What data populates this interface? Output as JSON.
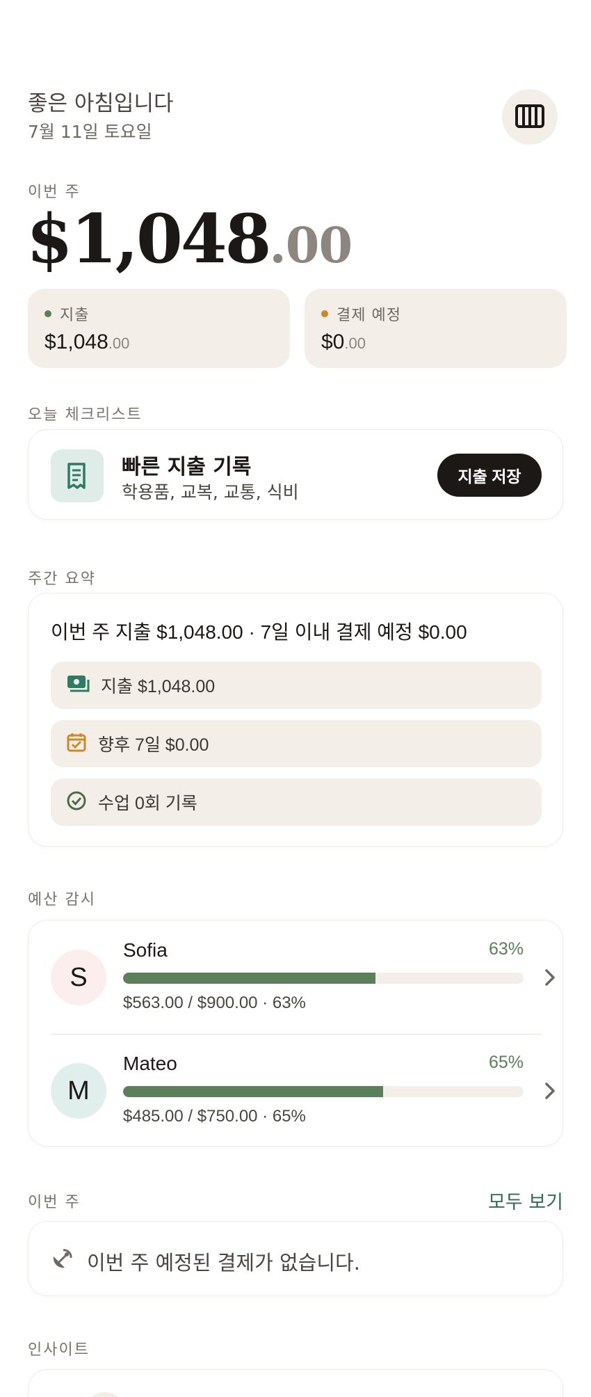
{
  "header": {
    "greeting": "좋은 아침입니다",
    "date": "7월 11일 토요일",
    "menu_icon": "columns-icon"
  },
  "this_week": {
    "label": "이번 주",
    "amount_main": "$1,048",
    "amount_cents": ".00"
  },
  "stats": [
    {
      "label": "지출",
      "dot_color": "#5b7f5a",
      "value_main": "$1,048",
      "value_cents": ".00"
    },
    {
      "label": "결제 예정",
      "dot_color": "#c98a2a",
      "value_main": "$0",
      "value_cents": ".00"
    }
  ],
  "checklist": {
    "label": "오늘 체크리스트",
    "title": "빠른 지출 기록",
    "subtitle": "학용품, 교복, 교통, 식비",
    "button": "지출 저장",
    "icon": "receipt-icon"
  },
  "summary": {
    "label": "주간 요약",
    "title": "이번 주 지출 $1,048.00 · 7일 이내 결제 예정 $0.00",
    "items": [
      {
        "icon": "cash-icon",
        "text": "지출 $1,048.00"
      },
      {
        "icon": "calendar-check-icon",
        "text": "향후 7일 $0.00"
      },
      {
        "icon": "check-circle-icon",
        "text": "수업 0회 기록"
      }
    ]
  },
  "budget": {
    "label": "예산 감시",
    "rows": [
      {
        "initial": "S",
        "name": "Sofia",
        "percent_label": "63%",
        "progress": 0.63,
        "detail": "$563.00 / $900.00 · 63%",
        "avatar_bg": "#fbeeec"
      },
      {
        "initial": "M",
        "name": "Mateo",
        "percent_label": "65%",
        "progress": 0.65,
        "detail": "$485.00 / $750.00 · 65%",
        "avatar_bg": "#e1efec"
      }
    ]
  },
  "upcoming": {
    "label": "이번 주",
    "see_all": "모두 보기",
    "empty_text": "이번 주 예정된 결제가 없습니다."
  },
  "insights": {
    "label": "인사이트"
  },
  "colors": {
    "accent_green": "#5b7f5a",
    "link_green": "#2e6b57",
    "orange": "#c98a2a",
    "card_beige": "#f3efe8"
  }
}
